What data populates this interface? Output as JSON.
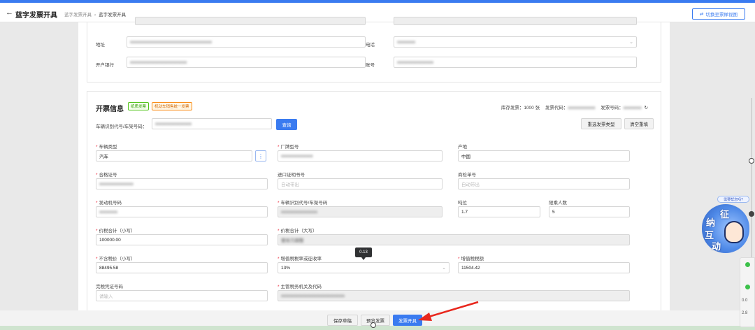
{
  "header": {
    "title": "蓝字发票开具",
    "breadcrumbs": [
      "蓝字发票开具",
      "蓝字发票开具"
    ],
    "switch_label": "切换至票样视图"
  },
  "buyer": {
    "address_label": "地址",
    "address_value": "xxxxxxxxxxxxxxxxxxxxxxxxxxxxxxxxxxxx",
    "phone_label": "电话",
    "phone_value": "xxxxxxxx",
    "bank_label": "开户银行",
    "bank_value": "xxxxxxxxxxxxxxxxxxxxxxxxx",
    "account_label": "账号",
    "account_value": "xxxxxxxxxxxxxxxx"
  },
  "invoice": {
    "title": "开票信息",
    "tag1": "纸质发票",
    "tag2": "机动车销售统一发票",
    "stock_label": "库存发票：1000 张",
    "code_label": "发票代码：",
    "code_value": "xxxxxxxxxxxx",
    "number_label": "发票号码：",
    "number_value": "xxxxxxxx",
    "vin_search_label": "车辆识别代号/车架号码：",
    "vin_search_value": "xxxxxxxxxxxxxxxx",
    "query_button": "查询",
    "reselect_button": "重选发票类型",
    "clear_button": "清空重填"
  },
  "fields": {
    "vehicle_type_label": "车辆类型",
    "vehicle_type_value": "汽车",
    "brand_model_label": "厂牌型号",
    "brand_model_value": "xxxxxxxxxxxxxx",
    "origin_label": "产地",
    "origin_value": "中国",
    "cert_no_label": "合格证号",
    "cert_no_value": "xxxxxxxxxxxxxxx",
    "import_cert_label": "进口证明书号",
    "import_cert_placeholder": "自动带出",
    "inspection_label": "商检单号",
    "inspection_placeholder": "自动带出",
    "engine_label": "发动机号码",
    "engine_value": "xxxxxxxx",
    "vin_label": "车辆识别代号/车架号码",
    "vin_value": "xxxxxxxxxxxxxxxx",
    "tonnage_label": "吨位",
    "tonnage_value": "1.7",
    "seats_label": "限乘人数",
    "seats_value": "5",
    "total_small_label": "价税合计（小写）",
    "total_small_value": "100000.00",
    "total_big_label": "价税合计（大写）",
    "total_big_value": "壹拾万圆整",
    "untaxed_label": "不含税价（小写）",
    "untaxed_value": "88495.58",
    "tax_rate_label": "增值税税率或征收率",
    "tax_rate_value": "13%",
    "tax_amount_label": "增值税税额",
    "tax_amount_value": "11504.42",
    "duty_free_label": "完税凭证号码",
    "duty_free_placeholder": "请输入",
    "authority_label": "主管税务机关及代码",
    "authority_value": "xxxxxxxxxxxxxxxxxxxxxxxxxxxx"
  },
  "tooltip": "0.13",
  "footer": {
    "save_draft": "保存草稿",
    "preview": "预览发票",
    "issue": "发票开具"
  },
  "assistant": {
    "bubble": "需要帮您吗?",
    "chars": [
      "征",
      "纳",
      "互",
      "动"
    ]
  },
  "side_panel": {
    "value1": "0.0",
    "value2": "2.8"
  },
  "colors": {
    "primary": "#3a7bf0",
    "arrow": "#e8261c"
  }
}
